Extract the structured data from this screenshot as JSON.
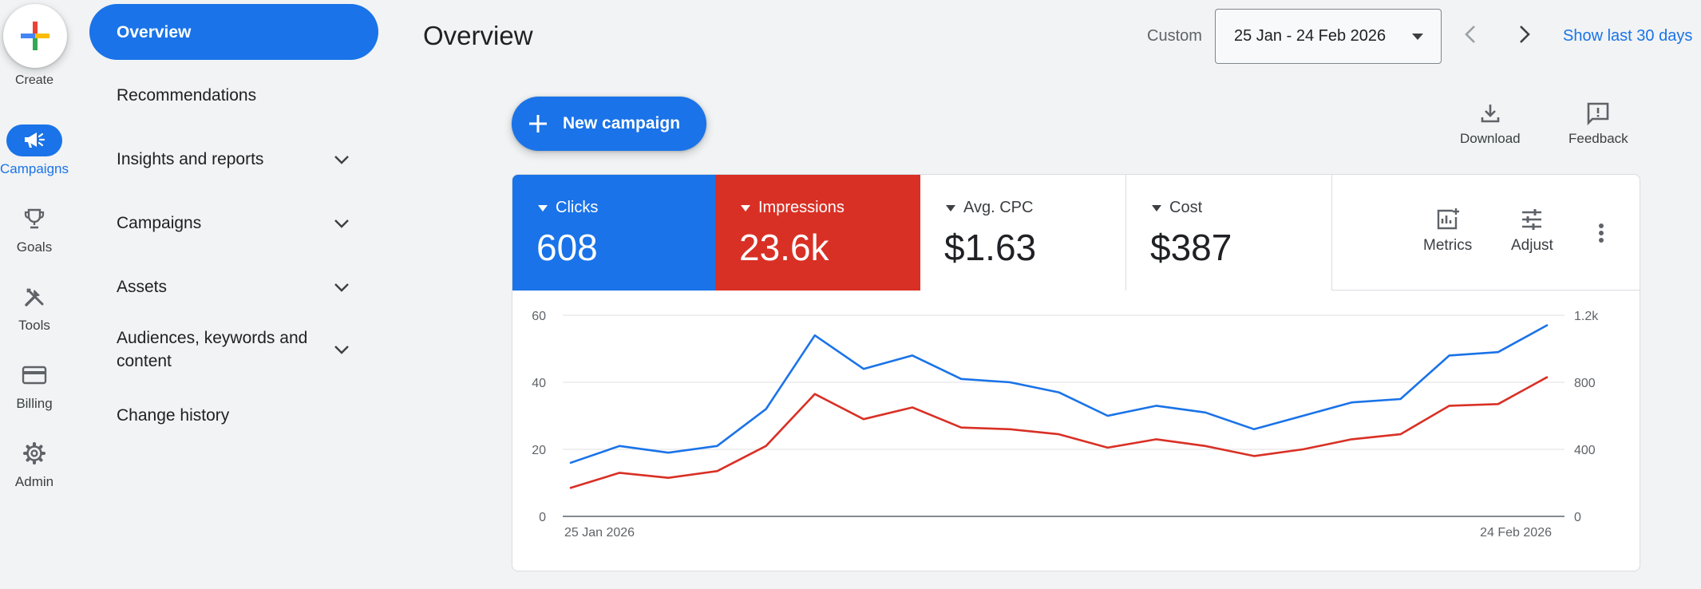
{
  "rail": {
    "create_label": "Create",
    "items": [
      {
        "label": "Campaigns",
        "icon": "megaphone-icon",
        "active": true
      },
      {
        "label": "Goals",
        "icon": "trophy-icon"
      },
      {
        "label": "Tools",
        "icon": "tools-icon"
      },
      {
        "label": "Billing",
        "icon": "credit-card-icon"
      },
      {
        "label": "Admin",
        "icon": "gear-icon"
      }
    ]
  },
  "subnav": {
    "items": [
      {
        "label": "Overview",
        "active": true
      },
      {
        "label": "Recommendations"
      },
      {
        "label": "Insights and reports",
        "expandable": true
      },
      {
        "label": "Campaigns",
        "expandable": true
      },
      {
        "label": "Assets",
        "expandable": true
      },
      {
        "label": "Audiences, keywords and content",
        "expandable": true
      },
      {
        "label": "Change history"
      }
    ]
  },
  "header": {
    "title": "Overview",
    "custom_label": "Custom",
    "date_range": "25 Jan - 24 Feb 2026",
    "show_last": "Show last 30 days"
  },
  "actions": {
    "new_campaign": "New campaign",
    "download": "Download",
    "feedback": "Feedback"
  },
  "metrics": [
    {
      "label": "Clicks",
      "value": "608",
      "color": "#1a73e8",
      "selected": true
    },
    {
      "label": "Impressions",
      "value": "23.6k",
      "color": "#d93025",
      "selected": true
    },
    {
      "label": "Avg. CPC",
      "value": "$1.63",
      "selected": false
    },
    {
      "label": "Cost",
      "value": "$387",
      "selected": false
    }
  ],
  "metric_tools": {
    "metrics": "Metrics",
    "adjust": "Adjust"
  },
  "colors": {
    "accent": "#1a73e8",
    "red": "#d93025"
  },
  "chart_data": {
    "type": "line",
    "x": [
      "25 Jan 2026",
      "",
      "",
      "",
      "",
      "",
      "",
      "",
      "",
      "",
      "",
      "",
      "",
      "",
      "",
      "",
      "",
      "",
      "",
      "",
      "",
      "24 Feb 2026"
    ],
    "x_tick_labels": [
      "25 Jan 2026",
      "24 Feb 2026"
    ],
    "y_left_ticks": [
      "0",
      "20",
      "40",
      "60"
    ],
    "y_right_ticks": [
      "0",
      "400",
      "800",
      "1.2k"
    ],
    "y_left_range": [
      0,
      60
    ],
    "y_right_range": [
      0,
      1200
    ],
    "grid": true,
    "series": [
      {
        "name": "Clicks",
        "axis": "left",
        "color": "#1a73e8",
        "values": [
          16,
          21,
          19,
          21,
          32,
          54,
          44,
          48,
          41,
          40,
          37,
          30,
          33,
          31,
          26,
          30,
          34,
          35,
          48,
          49,
          57
        ]
      },
      {
        "name": "Impressions",
        "axis": "right",
        "color": "#d93025",
        "values": [
          170,
          260,
          230,
          270,
          420,
          730,
          580,
          650,
          530,
          520,
          490,
          410,
          460,
          420,
          360,
          400,
          460,
          490,
          660,
          670,
          830
        ]
      }
    ]
  }
}
